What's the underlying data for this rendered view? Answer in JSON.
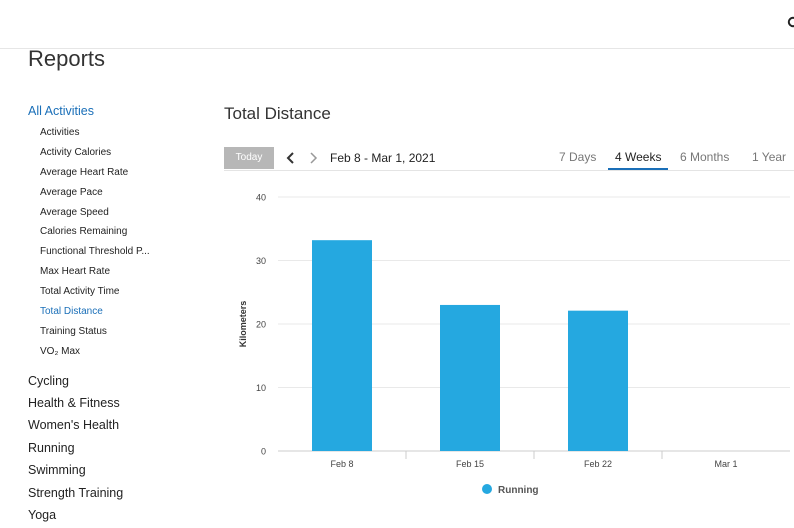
{
  "page": {
    "title": "Reports"
  },
  "sidebar": {
    "active_category": "All Activities",
    "sub_items": [
      {
        "label": "Activities",
        "active": false
      },
      {
        "label": "Activity Calories",
        "active": false
      },
      {
        "label": "Average Heart Rate",
        "active": false
      },
      {
        "label": "Average Pace",
        "active": false
      },
      {
        "label": "Average Speed",
        "active": false
      },
      {
        "label": "Calories Remaining",
        "active": false
      },
      {
        "label": "Functional Threshold P...",
        "active": false
      },
      {
        "label": "Max Heart Rate",
        "active": false
      },
      {
        "label": "Total Activity Time",
        "active": false
      },
      {
        "label": "Total Distance",
        "active": true
      },
      {
        "label": "Training Status",
        "active": false
      },
      {
        "label": "VO₂ Max",
        "active": false
      }
    ],
    "categories": [
      "Cycling",
      "Health & Fitness",
      "Women's Health",
      "Running",
      "Swimming",
      "Strength Training",
      "Yoga"
    ]
  },
  "report": {
    "title": "Total Distance",
    "today_label": "Today",
    "date_range": "Feb 8 - Mar 1, 2021",
    "tabs": [
      {
        "label": "7 Days",
        "active": false
      },
      {
        "label": "4 Weeks",
        "active": true
      },
      {
        "label": "6 Months",
        "active": false
      },
      {
        "label": "1 Year",
        "active": false
      }
    ]
  },
  "icons": {
    "prev": "chevron-left-icon",
    "next": "chevron-right-icon",
    "top_right": "search-icon"
  },
  "colors": {
    "accent": "#1a6fb8",
    "bar": "#25a8e0",
    "today_button": "#b7b7b7"
  },
  "chart_data": {
    "type": "bar",
    "categories": [
      "Feb 8",
      "Feb 15",
      "Feb 22",
      "Mar 1"
    ],
    "series": [
      {
        "name": "Running",
        "values": [
          33.2,
          23.0,
          22.1,
          0
        ]
      }
    ],
    "ylabel": "Kilometers",
    "xlabel": "",
    "ylim": [
      0,
      40
    ],
    "yticks": [
      0,
      10,
      20,
      30,
      40
    ],
    "grid": true,
    "legend": "bottom"
  }
}
